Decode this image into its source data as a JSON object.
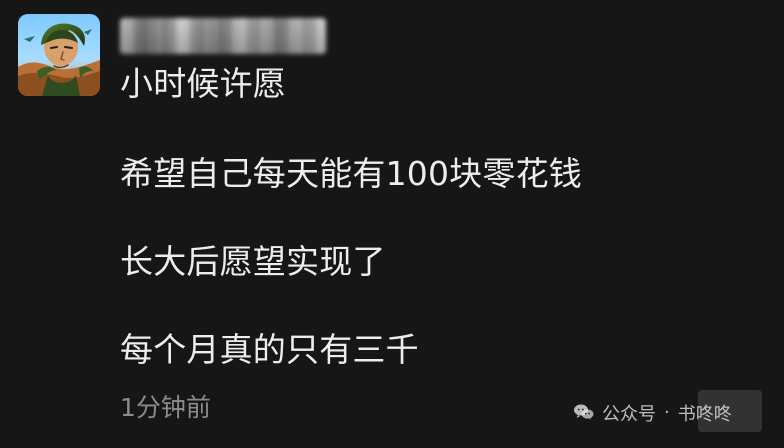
{
  "post": {
    "message_lines": [
      "小时候许愿",
      "希望自己每天能有100块零花钱",
      "长大后愿望实现了",
      "每个月真的只有三千"
    ],
    "timestamp": "1分钟前"
  },
  "watermark": {
    "source": "公众号",
    "separator": "·",
    "name": "书咚咚"
  }
}
